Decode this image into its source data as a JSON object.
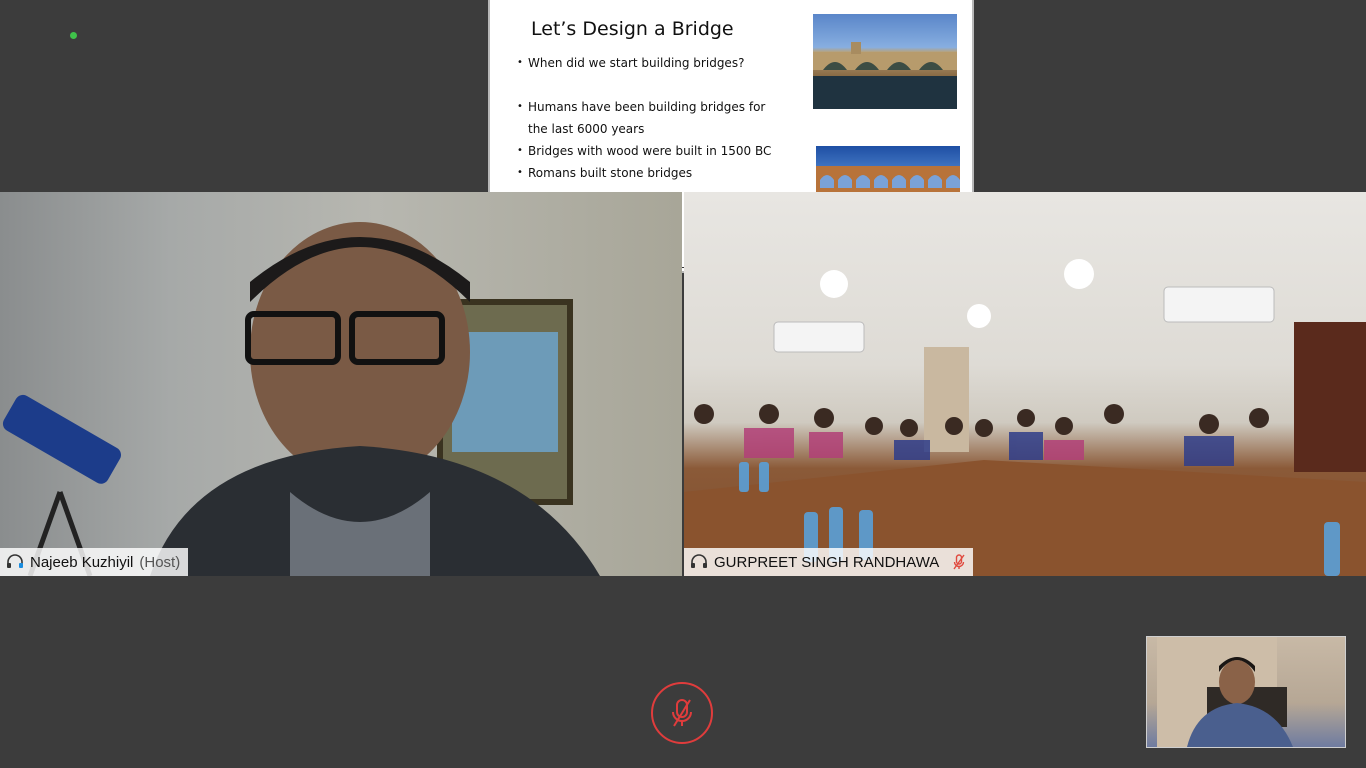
{
  "slide": {
    "title": "Let’s Design a Bridge",
    "bullets": [
      "When did we start building bridges?",
      "Humans have been building bridges for",
      "the last 6000 years",
      "Bridges with wood were built in 1500 BC",
      "Romans built stone bridges"
    ]
  },
  "participants": {
    "host": {
      "name": "Najeeb Kuzhiyil",
      "role": "(Host)"
    },
    "room": {
      "name": "GURPREET SINGH RANDHAWA"
    }
  },
  "colors": {
    "background": "#3c3c3c",
    "status_online": "#3fc24a",
    "muted_red": "#e03c3c"
  },
  "icons": {
    "mute": "mic-off-icon",
    "audio": "headset-icon"
  }
}
